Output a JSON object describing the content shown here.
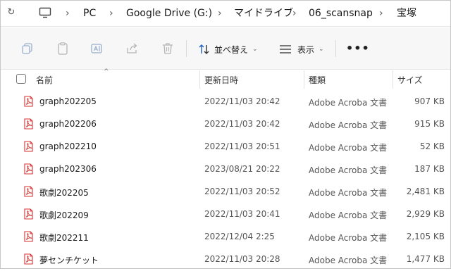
{
  "breadcrumb": {
    "items": [
      "PC",
      "Google Drive (G:)",
      "マイドライブ",
      "06_scansnap",
      "宝塚"
    ]
  },
  "toolbar": {
    "sort_label": "並べ替え",
    "view_label": "表示",
    "more_label": "•••"
  },
  "columns": {
    "name": "名前",
    "modified": "更新日時",
    "type": "種類",
    "size": "サイズ"
  },
  "files": [
    {
      "name": "graph202205",
      "modified": "2022/11/03 20:42",
      "type": "Adobe Acroba 文書",
      "size": "907 KB"
    },
    {
      "name": "graph202206",
      "modified": "2022/11/03 20:42",
      "type": "Adobe Acroba 文書",
      "size": "915 KB"
    },
    {
      "name": "graph202210",
      "modified": "2022/11/03 20:51",
      "type": "Adobe Acroba 文書",
      "size": "52 KB"
    },
    {
      "name": "graph202306",
      "modified": "2023/08/21 20:22",
      "type": "Adobe Acroba 文書",
      "size": "187 KB"
    },
    {
      "name": "歌劇202205",
      "modified": "2022/11/03 20:52",
      "type": "Adobe Acroba 文書",
      "size": "2,481 KB"
    },
    {
      "name": "歌劇202209",
      "modified": "2022/11/03 20:41",
      "type": "Adobe Acroba 文書",
      "size": "2,929 KB"
    },
    {
      "name": "歌劇202211",
      "modified": "2022/12/04 2:25",
      "type": "Adobe Acroba 文書",
      "size": "2,105 KB"
    },
    {
      "name": "夢センチケット",
      "modified": "2022/11/03 20:28",
      "type": "Adobe Acroba 文書",
      "size": "1,477 KB"
    }
  ],
  "colors": {
    "pdf_icon": "#d32f2f",
    "toolbar_bg": "#f7f7f7"
  }
}
